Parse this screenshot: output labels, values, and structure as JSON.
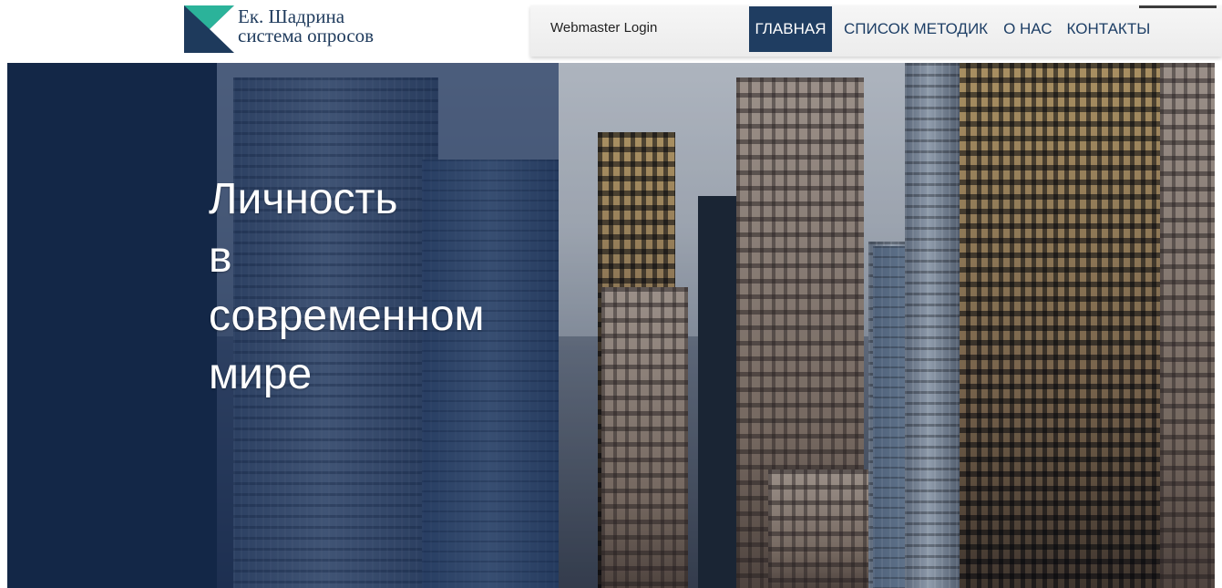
{
  "logo": {
    "line1": "Ек. Шадрина",
    "line2": "система опросов",
    "icon": "logo-mark-icon",
    "colors": {
      "teal": "#2bb39a",
      "navy": "#1e3a5c"
    }
  },
  "header": {
    "webmaster_label": "Webmaster Login"
  },
  "nav": {
    "items": [
      {
        "label": "ГЛАВНАЯ",
        "active": true
      },
      {
        "label": "СПИСОК МЕТОДИК",
        "active": false
      },
      {
        "label": "О НАС",
        "active": false
      },
      {
        "label": "КОНТАКТЫ",
        "active": false
      }
    ]
  },
  "hero": {
    "lines": [
      "Личность",
      "в",
      "современном",
      "мире"
    ],
    "overlay_color": "#102854"
  },
  "colors": {
    "nav_active_bg": "#1f3d61",
    "nav_text": "#1e3f66"
  }
}
